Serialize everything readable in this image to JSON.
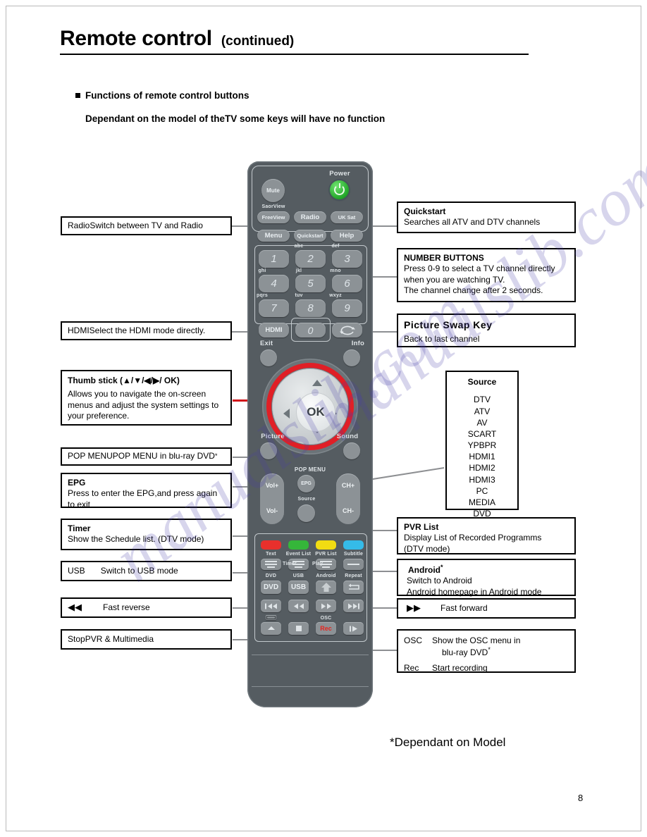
{
  "header": {
    "title": "Remote control",
    "continued": "(continued)",
    "bullet_heading": "Functions of remote control buttons",
    "subheading": "Dependant on the model of theTV some keys will have no function"
  },
  "footer": {
    "note": "*Dependant on Model",
    "page_number": "8"
  },
  "watermark": {
    "text": "manualslib.com"
  },
  "colors": {
    "body": "#555c61",
    "key": "#8c9296",
    "power_green": "#23a62a",
    "highlight_red": "#e01f26",
    "red_key": "#e8302c",
    "green_key": "#35b63a",
    "yellow_key": "#f2dc12",
    "cyan_key": "#35bbe8",
    "rec_red": "#e8231d"
  },
  "callouts_left": [
    {
      "id": "radio",
      "key": "Radio",
      "value": "Switch between TV and Radio"
    },
    {
      "id": "hdmi",
      "key": "HDMI",
      "value": "Select the HDMI mode directly."
    },
    {
      "id": "thumbstick",
      "title": "Thumb stick (▲/▼/◀/▶/ OK)",
      "text": "Allows you to navigate the on-screen menus and adjust the system settings to your preference."
    },
    {
      "id": "popmenu",
      "key": "POP MENU",
      "value": "POP MENU in blu-ray DVD",
      "star": "*"
    },
    {
      "id": "epg",
      "title": "EPG",
      "text": "Press to enter the EPG,and press again to exit"
    },
    {
      "id": "timer",
      "title": "Timer",
      "text": "Show the Schedule list. (DTV mode)"
    },
    {
      "id": "usb",
      "key": "USB",
      "value": "Switch to USB mode"
    },
    {
      "id": "fast-reverse",
      "key": "◀◀",
      "value": "Fast reverse"
    },
    {
      "id": "stop",
      "key": "Stop",
      "value": "PVR & Multimedia"
    }
  ],
  "callouts_right": [
    {
      "id": "quickstart",
      "title": "Quickstart",
      "text": "Searches all ATV and DTV channels"
    },
    {
      "id": "number-buttons",
      "title": "NUMBER BUTTONS",
      "line1": "Press 0-9 to select a TV channel directly",
      "line2": "when you are watching TV.",
      "line3": "The channel change after 2 seconds."
    },
    {
      "id": "picture-swap",
      "title": "Picture Swap Key",
      "text": "Back to last channel"
    },
    {
      "id": "source",
      "title": "Source",
      "items": [
        "DTV",
        "ATV",
        "AV",
        "SCART",
        "YPBPR",
        "HDMI1",
        "HDMI2",
        "HDMI3",
        "PC",
        "MEDIA",
        "DVD"
      ]
    },
    {
      "id": "pvr-list",
      "title": "PVR List",
      "line1": "Display List of Recorded Programms",
      "line2": "(DTV mode)"
    },
    {
      "id": "android",
      "title": "Android",
      "star": "*",
      "line1": "Switch to Android",
      "line2": "Android homepage in Android mode"
    },
    {
      "id": "fast-forward",
      "key": "▶▶",
      "value": "Fast forward"
    },
    {
      "id": "osc-rec",
      "key1": "OSC",
      "value1a": "Show the OSC menu in",
      "value1b": "blu-ray DVD",
      "star": "*",
      "key2": "Rec",
      "value2": "Start recording"
    }
  ],
  "remote": {
    "power_label": "Power",
    "mute": "Mute",
    "saorview": "SaorView",
    "freeview": "FreeView",
    "radio": "Radio",
    "uksat": "UK Sat",
    "menu": "Menu",
    "quickstart": "Quickstart",
    "help": "Help",
    "numpad": [
      {
        "digit": "1",
        "letters": ""
      },
      {
        "digit": "2",
        "letters": "abc"
      },
      {
        "digit": "3",
        "letters": "def"
      },
      {
        "digit": "4",
        "letters": "ghi"
      },
      {
        "digit": "5",
        "letters": "jkl"
      },
      {
        "digit": "6",
        "letters": "mno"
      },
      {
        "digit": "7",
        "letters": "pqrs"
      },
      {
        "digit": "8",
        "letters": "tuv"
      },
      {
        "digit": "9",
        "letters": "wxyz"
      }
    ],
    "hdmi": "HDMI",
    "zero": "0",
    "exit": "Exit",
    "info": "Info",
    "ok": "OK",
    "picture": "Picture",
    "sound": "Sound",
    "pop_menu": "POP MENU",
    "vol_plus": "Vol+",
    "vol_minus": "Vol-",
    "ch_plus": "CH+",
    "ch_minus": "CH-",
    "epg": "EPG",
    "source": "Source",
    "color_row": [
      "Text",
      "Event List",
      "PVR List",
      "Subtitle"
    ],
    "func_row": [
      "Timer",
      "Play",
      "Repeat"
    ],
    "mode_row": [
      "DVD",
      "USB",
      "Android",
      "Repeat"
    ],
    "mode_keys": [
      "DVD",
      "USB"
    ],
    "osc": "OSC",
    "rec": "Rec"
  }
}
